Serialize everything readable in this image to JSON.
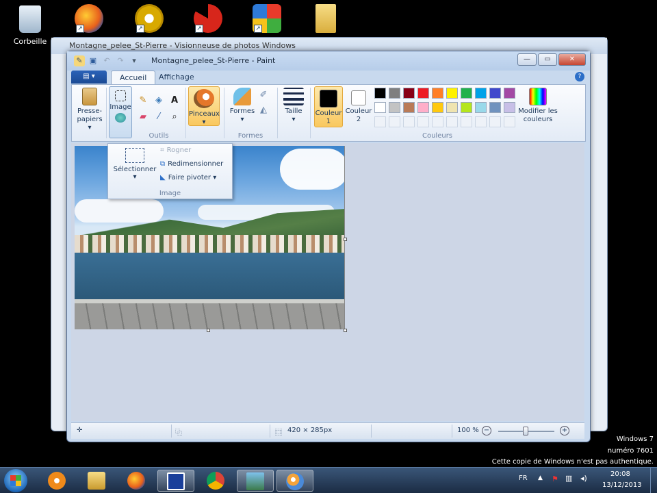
{
  "desktop": {
    "icons": [
      {
        "label": "Corbeille",
        "icon": "recycle-bin-icon"
      },
      {
        "label": "",
        "icon": "firefox-icon"
      },
      {
        "label": "",
        "icon": "chrome-icon"
      },
      {
        "label": "",
        "icon": "ccleaner-icon"
      },
      {
        "label": "",
        "icon": "windows-update-icon"
      },
      {
        "label": "",
        "icon": "folder-icon"
      }
    ]
  },
  "bg_window": {
    "title": "Montagne_pelee_St-Pierre - Visionneuse de photos Windows"
  },
  "paint": {
    "title": "Montagne_pelee_St-Pierre - Paint",
    "tabs": {
      "file": "▾",
      "home": "Accueil",
      "view": "Affichage"
    },
    "help": "?",
    "ribbon": {
      "clipboard": {
        "label_line1": "Presse-",
        "label_line2": "papiers ▾"
      },
      "image": {
        "label": "Image"
      },
      "tools_group": "Outils",
      "brushes": {
        "label": "Pinceaux",
        "arrow": "▾"
      },
      "shapes": {
        "label": "Formes",
        "arrow": "▾",
        "group": "Formes"
      },
      "size": {
        "label": "Taille",
        "arrow": "▾"
      },
      "color1": {
        "line1": "Couleur",
        "line2": "1"
      },
      "color2": {
        "line1": "Couleur",
        "line2": "2"
      },
      "edit_colors": {
        "line1": "Modifier les",
        "line2": "couleurs"
      },
      "colors_group": "Couleurs"
    },
    "palette_row1": [
      "#000000",
      "#7f7f7f",
      "#880015",
      "#ed1c24",
      "#ff7f27",
      "#fff200",
      "#22b14c",
      "#00a2e8",
      "#3f48cc",
      "#a349a4"
    ],
    "palette_row2": [
      "#ffffff",
      "#c3c3c3",
      "#b97a57",
      "#ffaec9",
      "#ffc90e",
      "#efe4b0",
      "#b5e61d",
      "#99d9ea",
      "#7092be",
      "#c8bfe7"
    ],
    "image_menu": {
      "select": "Sélectionner",
      "select_arrow": "▾",
      "crop": "Rogner",
      "resize": "Redimensionner",
      "rotate": "Faire pivoter ▾",
      "group": "Image"
    },
    "status": {
      "move_icon": "✛",
      "size": "420 × 285px",
      "zoom": "100 %",
      "minus": "−",
      "plus": "+"
    }
  },
  "watermark": {
    "line1": "Windows 7",
    "line2": "numéro 7601",
    "line3": "Cette copie de Windows n'est pas authentique."
  },
  "taskbar": {
    "lang": "FR",
    "time": "20:08",
    "date": "13/12/2013"
  }
}
